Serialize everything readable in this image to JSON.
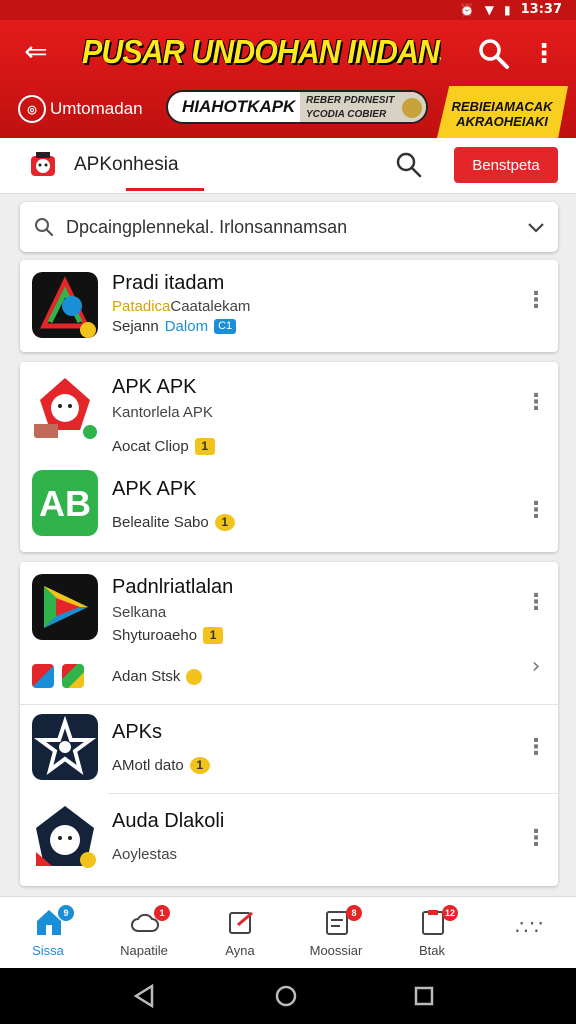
{
  "status_bar": {
    "time": "13:37"
  },
  "header": {
    "title": "PUSAR UNDOHAN INDANSH",
    "brand": "Umtomadan",
    "banner_main": "HIAHOTKAPK",
    "banner_sub_1": "REBER PDRNESIT",
    "banner_sub_2": "YCODIA COBIER",
    "banner_right": "REBIEIAMACAK AKRAOHEIAKI"
  },
  "tabs": {
    "active_label": "APKonhesia",
    "button_label": "Benstpeta"
  },
  "search": {
    "placeholder": "Dpcaingplennekal. Irlonsannamsan"
  },
  "cards": [
    {
      "rows": [
        {
          "name": "Pradi itadam",
          "sub_highlight": "Patadica",
          "sub": "Caatalekam",
          "meta": "Sejann",
          "meta_link": "Dalom",
          "badge": "C1"
        }
      ]
    },
    {
      "rows": [
        {
          "name": "APK APK",
          "sub": "Kantorlela APK",
          "meta": "Aocat Cliop",
          "badge": "1"
        },
        {
          "name": "APK APK",
          "meta": "Belealite Sabo",
          "badge": "1"
        }
      ]
    },
    {
      "rows": [
        {
          "name": "Padnlriatlalan",
          "sub": "Selkana",
          "meta": "Shyturoaeho",
          "badge": "1",
          "extra_label": "Adan Stsk"
        },
        {
          "name": "APKs",
          "meta": "AMotl dato",
          "badge": "1"
        },
        {
          "name": "Auda Dlakoli",
          "meta": "Aoylestas"
        }
      ]
    }
  ],
  "bottom_nav": [
    {
      "label": "Sissa",
      "badge": "9",
      "badge_color": "#1a8fd8"
    },
    {
      "label": "Napatile",
      "badge": "1",
      "badge_color": "#e4262a"
    },
    {
      "label": "Ayna",
      "badge": "",
      "badge_color": "#e4262a"
    },
    {
      "label": "Moossiar",
      "badge": "8",
      "badge_color": "#e4262a"
    },
    {
      "label": "Btak",
      "badge": "12",
      "badge_color": "#e4262a"
    }
  ],
  "colors": {
    "primary_red": "#e41b1b",
    "accent_yellow": "#ffe81a",
    "link_blue": "#1a8fd8"
  }
}
